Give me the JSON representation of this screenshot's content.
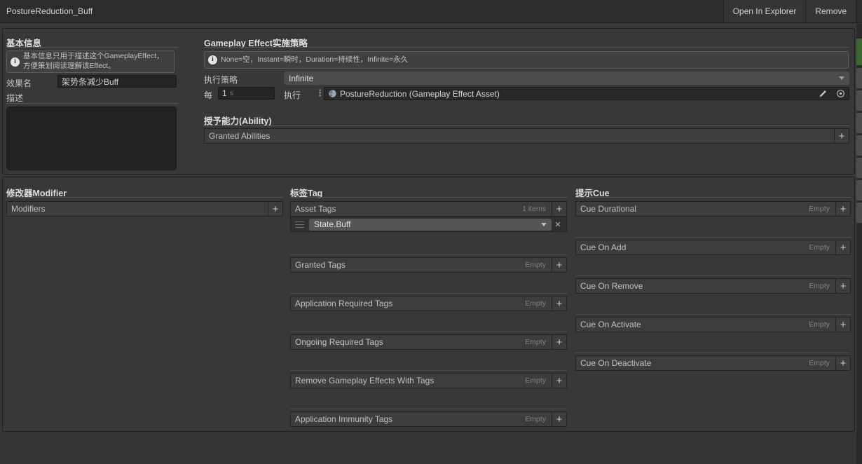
{
  "title_bar": {
    "title": "PostureReduction_Buff",
    "open_in_explorer_label": "Open In Explorer",
    "remove_label": "Remove"
  },
  "basic_info": {
    "header": "基本信息",
    "help_text": "基本信息只用于描述这个GameplayEffect，方便策划阅读理解该Effect。",
    "effect_name_label": "效果名",
    "effect_name_value": "架势条减少Buff",
    "description_label": "描述",
    "description_value": ""
  },
  "policy": {
    "header": "Gameplay Effect实施策略",
    "help_text": "None=空，Instant=瞬时，Duration=持续性，Infinite=永久",
    "exec_policy_label": "执行策略",
    "exec_policy_value": "Infinite",
    "period_label": "每",
    "period_value": "1",
    "period_unit": "s",
    "exec_label": "执行",
    "exec_asset": "PostureReduction (Gameplay Effect Asset)"
  },
  "ability": {
    "header": "授予能力(Ability)",
    "list_label": "Granted Abilities"
  },
  "modifiers": {
    "header": "修改器Modifier",
    "list_label": "Modifiers"
  },
  "tags": {
    "header": "标签Tag",
    "lists": [
      {
        "label": "Asset Tags",
        "badge": "1 items"
      },
      {
        "label": "Granted Tags",
        "badge": "Empty"
      },
      {
        "label": "Application Required Tags",
        "badge": "Empty"
      },
      {
        "label": "Ongoing Required Tags",
        "badge": "Empty"
      },
      {
        "label": "Remove Gameplay Effects With Tags",
        "badge": "Empty"
      },
      {
        "label": "Application Immunity Tags",
        "badge": "Empty"
      }
    ],
    "asset_tag_items": [
      "State.Buff"
    ]
  },
  "cues": {
    "header": "提示Cue",
    "lists": [
      {
        "label": "Cue Durational",
        "badge": "Empty"
      },
      {
        "label": "Cue On Add",
        "badge": "Empty"
      },
      {
        "label": "Cue On Remove",
        "badge": "Empty"
      },
      {
        "label": "Cue On Activate",
        "badge": "Empty"
      },
      {
        "label": "Cue On Deactivate",
        "badge": "Empty"
      }
    ]
  },
  "icons": {
    "plus": "+",
    "close": "✕",
    "info": "i",
    "more_vertical": "⋮"
  },
  "colors": {
    "window_bg": "#383838",
    "titlebar_bg": "#2C2C2C",
    "panel_border": "#1F1F1F",
    "helpbox_bg": "#404040",
    "field_bg": "#262626",
    "popup_bg": "#4C4C4C",
    "bar_bg": "#3D3D3D",
    "muted_text": "#828282",
    "strip_green": "#3E6832"
  }
}
